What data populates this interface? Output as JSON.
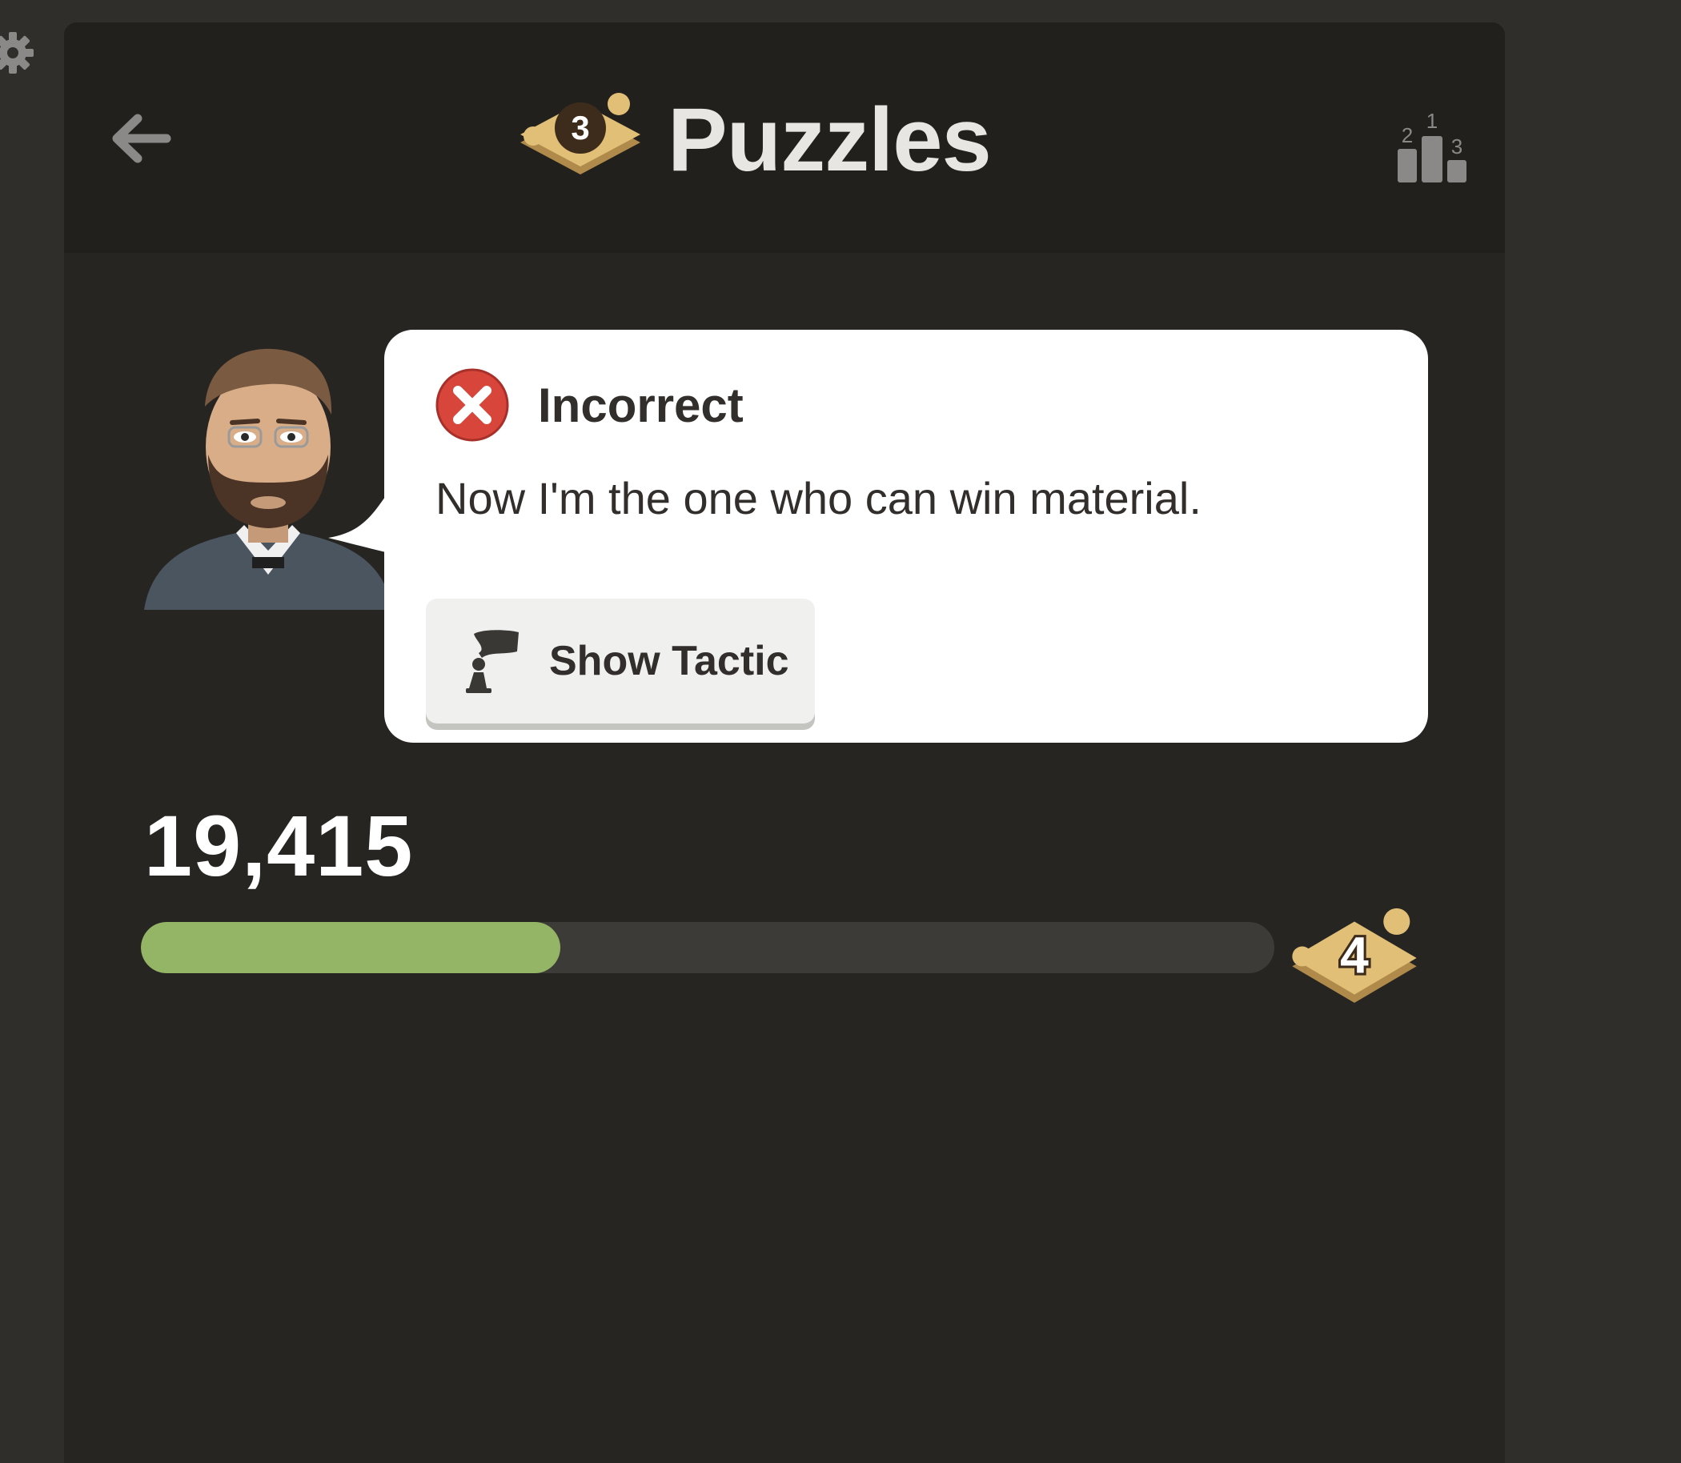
{
  "header": {
    "title": "Puzzles",
    "level_badge": "3",
    "back_icon": "arrow-left-icon",
    "leaderboard_icon": "leaderboard-icon",
    "leaderboard_ranks": [
      "1",
      "2",
      "3"
    ]
  },
  "settings_icon": "gear-icon",
  "feedback": {
    "status": "Incorrect",
    "status_icon": "x-circle-icon",
    "message": "Now I'm the one who can win material.",
    "action_label": "Show Tactic",
    "action_icon": "tactic-hint-icon"
  },
  "progress": {
    "score": "19,415",
    "fraction": 0.37,
    "next_level_badge": "4"
  },
  "colors": {
    "page_bg": "#302e2b",
    "panel_bg": "#262522",
    "header_bg": "#21201d",
    "progress_fill": "#95b566",
    "progress_track": "#3c3b38",
    "error_red": "#d8453a",
    "badge_gold": "#d9b56c"
  }
}
